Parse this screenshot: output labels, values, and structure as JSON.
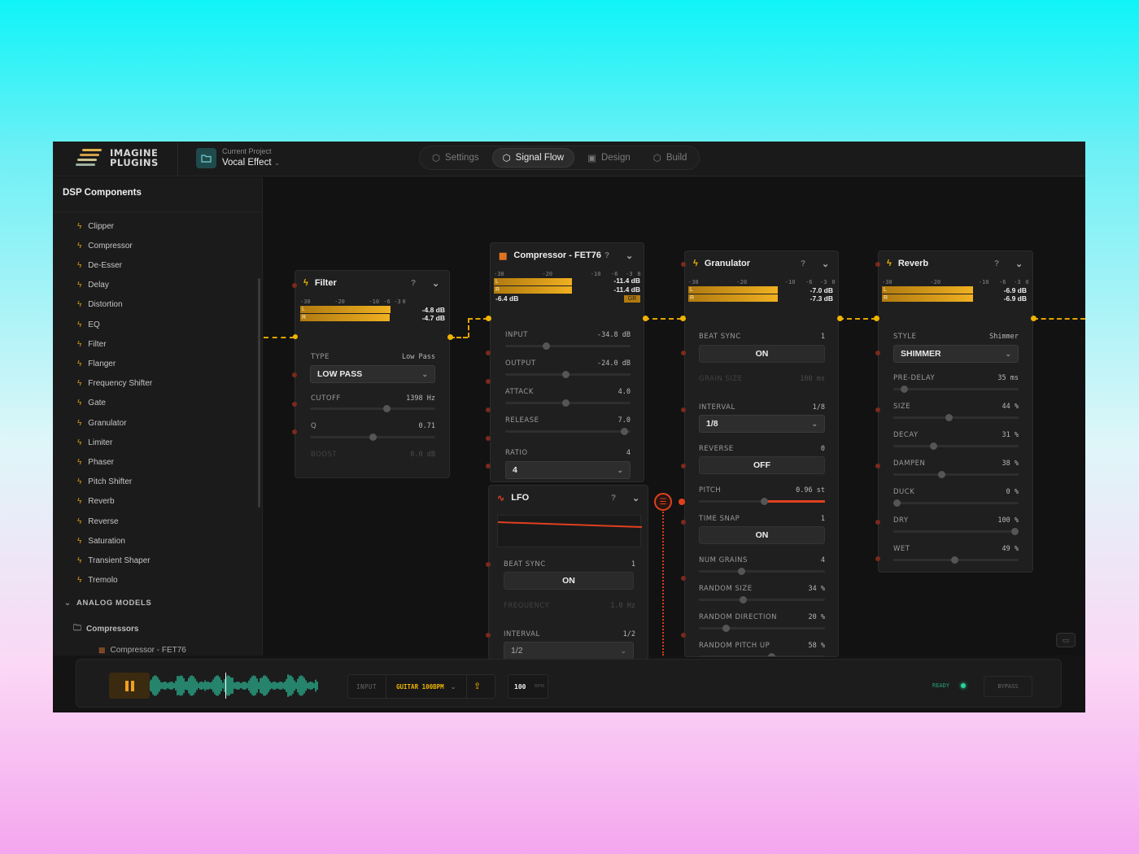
{
  "header": {
    "logo_line1": "IMAGINE",
    "logo_line2": "PLUGINS",
    "project_label": "Current Project",
    "project_name": "Vocal Effect",
    "tabs": [
      {
        "label": "Settings",
        "active": false
      },
      {
        "label": "Signal Flow",
        "active": true
      },
      {
        "label": "Design",
        "active": false
      },
      {
        "label": "Build",
        "active": false
      }
    ]
  },
  "sidebar": {
    "title": "DSP Components",
    "items": [
      "Clipper",
      "Compressor",
      "De-Esser",
      "Delay",
      "Distortion",
      "EQ",
      "Filter",
      "Flanger",
      "Frequency Shifter",
      "Gate",
      "Granulator",
      "Limiter",
      "Phaser",
      "Pitch Shifter",
      "Reverb",
      "Reverse",
      "Saturation",
      "Transient Shaper",
      "Tremolo"
    ],
    "section_label": "ANALOG MODELS",
    "folder_label": "Compressors",
    "subitem_label": "Compressor - FET76"
  },
  "meter_ticks": [
    "-30",
    "-20",
    "-10",
    "-6",
    "-3",
    "0"
  ],
  "panels": {
    "filter": {
      "title": "Filter",
      "meter": {
        "l_level": 0.87,
        "r_level": 0.86,
        "l_val": "-4.8 dB",
        "r_val": "-4.7 dB"
      },
      "type_label": "TYPE",
      "type_value": "Low Pass",
      "type_select": "LOW PASS",
      "cutoff_label": "CUTOFF",
      "cutoff_value": "1398 Hz",
      "cutoff_level": 0.62,
      "q_label": "Q",
      "q_value": "0.71",
      "q_level": 0.5,
      "boost_label": "BOOST",
      "boost_value": "0.0 dB"
    },
    "compressor": {
      "title": "Compressor - FET76",
      "meter": {
        "l_level": 0.58,
        "r_level": 0.58,
        "l_val": "-11.4 dB",
        "r_val": "-11.4 dB",
        "gr_val": "-6.4 dB",
        "gr_label": "GR"
      },
      "params": [
        {
          "label": "INPUT",
          "value": "-34.8 dB",
          "level": 0.32
        },
        {
          "label": "OUTPUT",
          "value": "-24.0 dB",
          "level": 0.48
        },
        {
          "label": "ATTACK",
          "value": "4.0",
          "level": 0.48
        },
        {
          "label": "RELEASE",
          "value": "7.0",
          "level": 0.98
        }
      ],
      "ratio_label": "RATIO",
      "ratio_value": "4",
      "ratio_select": "4"
    },
    "lfo": {
      "title": "LFO",
      "beat_sync_label": "BEAT SYNC",
      "beat_sync_value": "1",
      "beat_sync_toggle": "ON",
      "frequency_label": "FREQUENCY",
      "frequency_value": "1.0 Hz",
      "interval_label": "INTERVAL",
      "interval_value": "1/2",
      "interval_select": "1/2"
    },
    "granulator": {
      "title": "Granulator",
      "meter": {
        "l_level": 0.81,
        "r_level": 0.81,
        "l_val": "-7.0 dB",
        "r_val": "-7.3 dB"
      },
      "beat_sync_label": "BEAT SYNC",
      "beat_sync_value": "1",
      "beat_sync_toggle": "ON",
      "grain_size_label": "GRAIN SIZE",
      "grain_size_value": "100 ms",
      "interval_label": "INTERVAL",
      "interval_value": "1/8",
      "interval_select": "1/8",
      "reverse_label": "REVERSE",
      "reverse_value": "0",
      "reverse_toggle": "OFF",
      "pitch_label": "PITCH",
      "pitch_value": "0.96 st",
      "pitch_level": 0.52,
      "time_snap_label": "TIME SNAP",
      "time_snap_value": "1",
      "time_snap_toggle": "ON",
      "sliders": [
        {
          "label": "NUM GRAINS",
          "value": "4",
          "level": 0.33
        },
        {
          "label": "RANDOM SIZE",
          "value": "34 %",
          "level": 0.34
        },
        {
          "label": "RANDOM DIRECTION",
          "value": "20 %",
          "level": 0.2
        },
        {
          "label": "RANDOM PITCH UP",
          "value": "58 %",
          "level": 0.58
        }
      ]
    },
    "reverb": {
      "title": "Reverb",
      "meter": {
        "l_level": 0.82,
        "r_level": 0.82,
        "l_val": "-6.9 dB",
        "r_val": "-6.9 dB"
      },
      "style_label": "STYLE",
      "style_value": "Shimmer",
      "style_select": "SHIMMER",
      "sliders": [
        {
          "label": "PRE-DELAY",
          "value": "35 ms",
          "level": 0.06
        },
        {
          "label": "SIZE",
          "value": "44 %",
          "level": 0.44
        },
        {
          "label": "DECAY",
          "value": "31 %",
          "level": 0.31
        },
        {
          "label": "DAMPEN",
          "value": "38 %",
          "level": 0.38
        },
        {
          "label": "DUCK",
          "value": "0 %",
          "level": 0.0
        },
        {
          "label": "DRY",
          "value": "100 %",
          "level": 1.0
        },
        {
          "label": "WET",
          "value": "49 %",
          "level": 0.49
        }
      ]
    }
  },
  "transport": {
    "input_label": "INPUT",
    "input_select": "GUITAR 100BPM",
    "bpm_value": "100",
    "bpm_unit": "BPM",
    "ready_label": "READY",
    "bypass_label": "BYPASS"
  },
  "colors": {
    "accent": "#f0b400",
    "mod": "#e0401e",
    "ready": "#2ad39a",
    "wave": "#2bb090"
  }
}
